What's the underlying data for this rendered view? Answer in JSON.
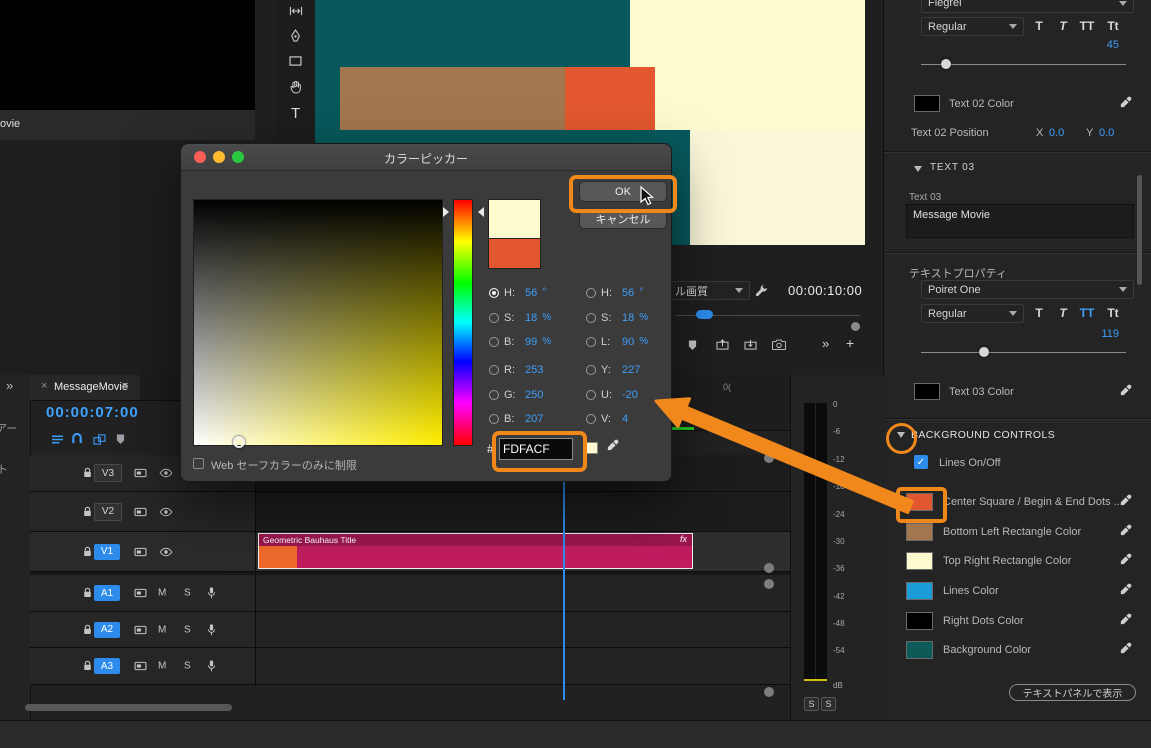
{
  "icons": {
    "double_chevron": "»",
    "plus": "+",
    "close": "×",
    "panel_menu": "≡",
    "check": "✓",
    "type_tool": "T"
  },
  "left_edge": {
    "tab_fragment": "ovie",
    "fragment_1": "アー",
    "fragment_2": "ト"
  },
  "monitor": {
    "quality_label": "ル画質",
    "timecode": "00:00:10:00",
    "graphic": {
      "background": "#07595C",
      "top_right_block": "#FDFACF",
      "bottom_right_block": "#FAF6D8",
      "left_bar": "#A3774E",
      "center_square": "#E2572F"
    }
  },
  "dialog": {
    "title": "カラーピッカー",
    "ok_label": "OK",
    "cancel_label": "キャンセル",
    "new_color": "#FDFACF",
    "current_color": "#E2572F",
    "left_fields": [
      {
        "label": "H:",
        "value": "56",
        "unit": "°"
      },
      {
        "label": "S:",
        "value": "18",
        "unit": "%"
      },
      {
        "label": "B:",
        "value": "99",
        "unit": "%"
      },
      {
        "label": "R:",
        "value": "253"
      },
      {
        "label": "G:",
        "value": "250"
      },
      {
        "label": "B:",
        "value": "207"
      }
    ],
    "right_fields": [
      {
        "label": "H:",
        "value": "56",
        "unit": "°"
      },
      {
        "label": "S:",
        "value": "18",
        "unit": "%"
      },
      {
        "label": "L:",
        "value": "90",
        "unit": "%"
      },
      {
        "label": "Y:",
        "value": "227"
      },
      {
        "label": "U:",
        "value": "-20"
      },
      {
        "label": "V:",
        "value": "4"
      }
    ],
    "hex_prefix": "#",
    "hex_value": "FDFACF",
    "websafe_label": "Web セーフカラーのみに制限"
  },
  "essential_graphics": {
    "font_1": "Flegrei",
    "style_1": "Regular",
    "type_buttons": [
      "T",
      "T",
      "TT",
      "Tt"
    ],
    "size_1": "45",
    "text02_color_label": "Text 02 Color",
    "text02_position_label": "Text 02 Position",
    "x_label": "X",
    "x_value": "0.0",
    "y_label": "Y",
    "y_value": "0.0",
    "text03_section": "TEXT 03",
    "text03_field_label": "Text 03",
    "text03_value": "Message Movie",
    "text_properties_label": "テキストプロパティ",
    "font_2": "Poiret One",
    "style_2": "Regular",
    "size_2": "119",
    "text03_color_label": "Text 03 Color",
    "bg_controls_title": "BACKGROUND CONTROLS",
    "lines_toggle_label": "Lines On/Off",
    "color_rows": [
      {
        "swatch": "#E0562E",
        "label": "Center Square / Begin & End Dots ..."
      },
      {
        "swatch": "#A3774E",
        "label": "Bottom Left Rectangle Color"
      },
      {
        "swatch": "#FDFACF",
        "label": "Top Right Rectangle Color"
      },
      {
        "swatch": "#1B9CD8",
        "label": "Lines Color"
      },
      {
        "swatch": "#000000",
        "label": "Right Dots Color"
      },
      {
        "swatch": "#0D5B58",
        "label": "Background Color"
      }
    ],
    "show_text_panel_label": "テキストパネルで表示"
  },
  "timeline": {
    "tab_label": "MessageMovie",
    "timecode": "00:00:07:00",
    "ruler_fragment": "0(",
    "video_tracks": [
      {
        "label": "V3"
      },
      {
        "label": "V2"
      },
      {
        "label": "V1"
      }
    ],
    "audio_tracks": [
      {
        "label": "A1"
      },
      {
        "label": "A2"
      },
      {
        "label": "A3"
      }
    ],
    "mute_label": "M",
    "solo_label": "S",
    "clip_title": "Geometric Bauhaus Title",
    "fx_label": "fx"
  },
  "meters": {
    "scale": [
      "0",
      "-6",
      "-12",
      "-18",
      "-24",
      "-30",
      "-36",
      "-42",
      "-48",
      "-54"
    ],
    "unit": "dB",
    "solo_left": "S",
    "solo_right": "S"
  }
}
